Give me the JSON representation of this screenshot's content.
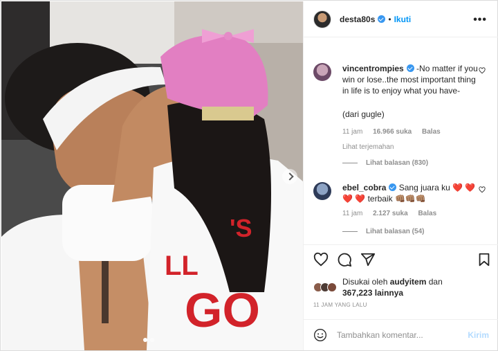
{
  "post": {
    "author": "desta80s",
    "follow_label": "Ikuti",
    "more_label": "•••",
    "photo_text": "GO",
    "photo_text_partial": "'S",
    "photo_text_small": "LL"
  },
  "comments": [
    {
      "username": "vincentrompies",
      "text": "-No matter if you win or lose..the most important thing in life is to enjoy what you have-",
      "extra": "(dari gugle)",
      "time": "11 jam",
      "likes": "16.966 suka",
      "reply": "Balas",
      "translate": "Lihat terjemahan",
      "view_replies": "Lihat balasan (830)"
    },
    {
      "username": "ebel_cobra",
      "text": "Sang juara ku",
      "hearts1": "❤️ ❤️",
      "hearts2": "❤️ ❤️",
      "text2": "terbaik",
      "hands": "👊🏽👊🏽👊🏽",
      "time": "11 jam",
      "likes": "2.127 suka",
      "reply": "Balas",
      "view_replies": "Lihat balasan (54)"
    }
  ],
  "likes": {
    "prefix": "Disukai oleh",
    "user": "audyitem",
    "and": "dan",
    "count": "367,223",
    "others": "lainnya"
  },
  "timestamp": "11 JAM YANG LALU",
  "add_comment": {
    "placeholder": "Tambahkan komentar...",
    "post_label": "Kirim"
  },
  "colors": {
    "accent": "#0095f6",
    "heart": "#ed4956",
    "cap": "#e27fc2"
  }
}
